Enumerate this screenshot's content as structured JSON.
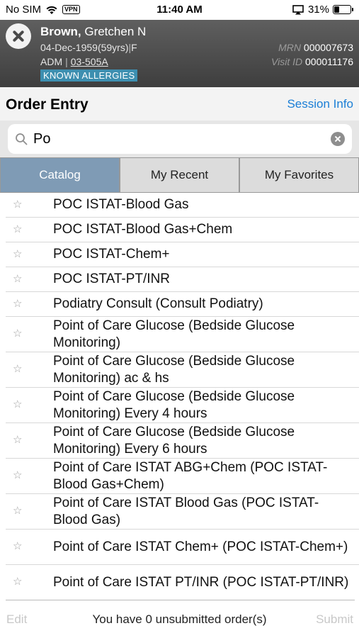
{
  "status_bar": {
    "carrier": "No SIM",
    "vpn": "VPN",
    "time": "11:40 AM",
    "battery_text": "31%",
    "battery_level": 0.31
  },
  "patient": {
    "last_name": "Brown,",
    "first_name": "Gretchen N",
    "dob": "04-Dec-1959",
    "age": "(59yrs)",
    "sex": "F",
    "encounter_type": "ADM",
    "room": "03-505A",
    "allergy_badge": "KNOWN ALLERGIES",
    "mrn_label": "MRN",
    "mrn": "000007673",
    "visit_label": "Visit ID",
    "visit_id": "000011176"
  },
  "header": {
    "title": "Order Entry",
    "session_link": "Session Info"
  },
  "search": {
    "value": "Po"
  },
  "tabs": [
    {
      "label": "Catalog",
      "active": true
    },
    {
      "label": "My Recent",
      "active": false
    },
    {
      "label": "My Favorites",
      "active": false
    }
  ],
  "orders": [
    {
      "label": "POC ISTAT-Blood Gas"
    },
    {
      "label": "POC ISTAT-Blood Gas+Chem"
    },
    {
      "label": "POC ISTAT-Chem+"
    },
    {
      "label": "POC ISTAT-PT/INR"
    },
    {
      "label": "Podiatry Consult (Consult Podiatry)"
    },
    {
      "label": "Point of Care Glucose (Bedside Glucose Monitoring)"
    },
    {
      "label": "Point of Care Glucose (Bedside Glucose Monitoring) ac & hs"
    },
    {
      "label": "Point of Care Glucose (Bedside Glucose Monitoring) Every 4 hours"
    },
    {
      "label": "Point of Care Glucose (Bedside Glucose Monitoring) Every 6 hours"
    },
    {
      "label": "Point of Care ISTAT ABG+Chem (POC ISTAT-Blood Gas+Chem)"
    },
    {
      "label": "Point of Care ISTAT Blood Gas (POC ISTAT-Blood Gas)"
    },
    {
      "label": "Point of Care ISTAT Chem+ (POC ISTAT-Chem+)"
    },
    {
      "label": "Point of Care ISTAT PT/INR (POC ISTAT-PT/INR)"
    }
  ],
  "footer": {
    "edit_label": "Edit",
    "status_text": "You have 0 unsubmitted order(s)",
    "submit_label": "Submit"
  },
  "colors": {
    "header_bg": "#4a4a4a",
    "accent_link": "#1a7ed6",
    "active_tab": "#7f9bb5",
    "allergy_badge": "#3d8fb0"
  }
}
